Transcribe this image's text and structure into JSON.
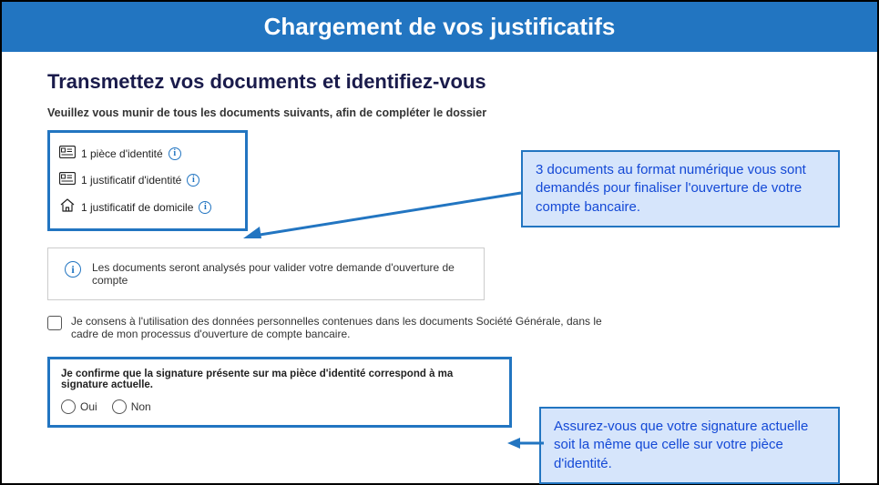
{
  "header": {
    "title": "Chargement de vos justificatifs"
  },
  "page": {
    "title": "Transmettez vos documents et identifiez-vous",
    "instruction": "Veuillez vous munir de tous les documents suivants, afin de compléter le dossier"
  },
  "documents": {
    "items": [
      {
        "label": "1 pièce d'identité"
      },
      {
        "label": "1 justificatif d'identité"
      },
      {
        "label": "1 justificatif de domicile"
      }
    ]
  },
  "notice": {
    "text": "Les documents seront analysés pour valider votre demande d'ouverture de compte"
  },
  "consent": {
    "text": "Je consens à l'utilisation des données personnelles contenues dans les documents Société Générale, dans le cadre de mon processus d'ouverture de compte bancaire."
  },
  "signature": {
    "title": "Je confirme que la signature présente sur ma pièce d'identité correspond à ma signature actuelle.",
    "options": {
      "yes": "Oui",
      "no": "Non"
    }
  },
  "callouts": {
    "c1": "3 documents au format numérique vous sont demandés pour finaliser l'ouverture de votre compte bancaire.",
    "c2": "Assurez-vous que votre signature actuelle soit la même que celle sur votre pièce d'identité."
  }
}
